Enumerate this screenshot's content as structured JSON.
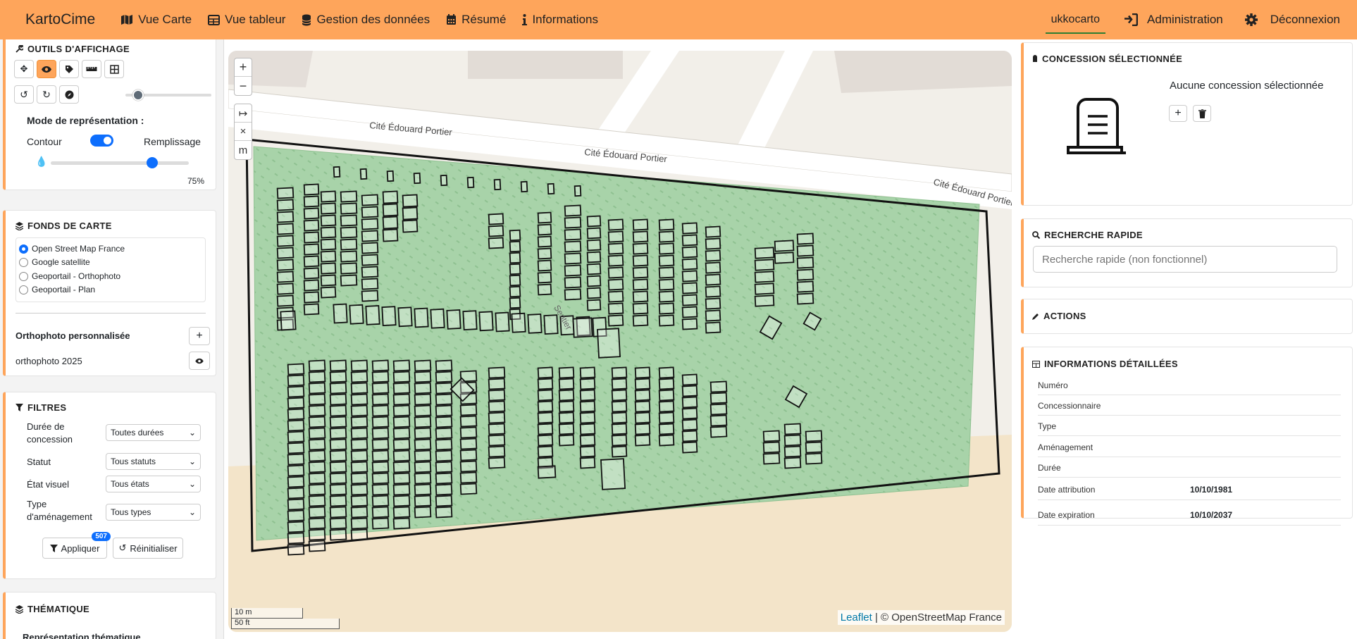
{
  "nav": {
    "brand": "KartoCime",
    "items": [
      "Vue Carte",
      "Vue tableur",
      "Gestion des données",
      "Résumé",
      "Informations"
    ],
    "user": "ukkocarto",
    "admin": "Administration",
    "logout": "Déconnexion"
  },
  "display_tools": {
    "title": "OUTILS D'AFFICHAGE",
    "mode_label": "Mode de représentation :",
    "contour": "Contour",
    "fill": "Remplissage",
    "toggle_on": true,
    "opacity": "75%",
    "opacity_value": 0.75,
    "zoom_slider_value": 0.1
  },
  "basemaps": {
    "title": "FONDS DE CARTE",
    "options": [
      "Open Street Map France",
      "Google satellite",
      "Geoportail - Orthophoto",
      "Geoportail - Plan"
    ],
    "selected": 0,
    "custom_label": "Orthophoto personnalisée",
    "custom_item": "orthophoto 2025"
  },
  "filters": {
    "title": "FILTRES",
    "rows": [
      {
        "label": "Durée de concession",
        "value": "Toutes durées"
      },
      {
        "label": "Statut",
        "value": "Tous statuts"
      },
      {
        "label": "État visuel",
        "value": "Tous états"
      },
      {
        "label": "Type d'aménagement",
        "value": "Tous types"
      }
    ],
    "apply": "Appliquer",
    "apply_count": "507",
    "reset": "Réinitialiser"
  },
  "thematic": {
    "title": "THÉMATIQUE",
    "sub": "Représentation thématique"
  },
  "map": {
    "streets": [
      "Cité Édouard Portier",
      "Cité Édouard Portier",
      "Cité Édouard Portier"
    ],
    "attribution_link": "Leaflet",
    "attribution_text": "| © OpenStreetMap France",
    "scale_m": "10 m",
    "scale_ft": "50 ft",
    "zoom_in": "+",
    "zoom_out": "−",
    "tool_m": "m",
    "tool_x": "×",
    "tool_arrow": "↦",
    "path_label": "Sentier",
    "colors": {
      "cemetery": "#a8d3a9",
      "sand": "#f3e4c9",
      "plot_stroke": "#111111"
    }
  },
  "selected": {
    "title": "CONCESSION SÉLECTIONNÉE",
    "none": "Aucune concession sélectionnée"
  },
  "search": {
    "title": "RECHERCHE RAPIDE",
    "placeholder": "Recherche rapide (non fonctionnel)"
  },
  "actions": {
    "title": "ACTIONS"
  },
  "details": {
    "title": "INFORMATIONS DÉTAILLÉES",
    "rows": [
      {
        "k": "Numéro",
        "v": ""
      },
      {
        "k": "Concessionnaire",
        "v": ""
      },
      {
        "k": "Type",
        "v": ""
      },
      {
        "k": "Aménagement",
        "v": ""
      },
      {
        "k": "Durée",
        "v": ""
      },
      {
        "k": "Date attribution",
        "v": "10/10/1981"
      },
      {
        "k": "Date expiration",
        "v": "10/10/2037"
      }
    ]
  }
}
